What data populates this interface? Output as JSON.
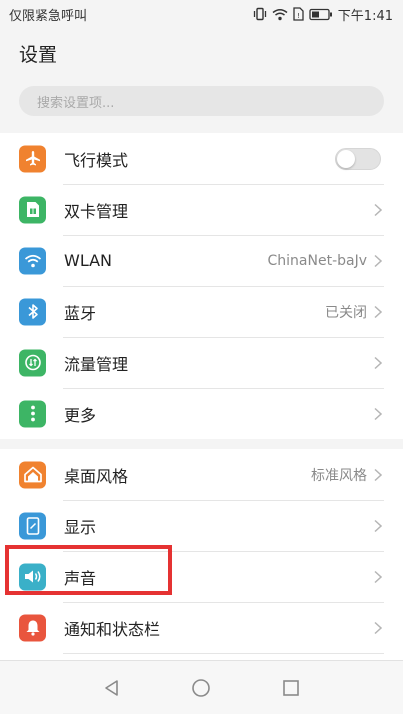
{
  "status_bar": {
    "carrier": "仅限紧急呼叫",
    "time": "下午1:41",
    "icons": [
      "vibrate-icon",
      "wifi-icon",
      "sim-icon",
      "battery-icon"
    ]
  },
  "page_title": "设置",
  "search": {
    "placeholder": "搜索设置项..."
  },
  "groups": [
    {
      "items": [
        {
          "label": "飞行模式",
          "icon": "airplane-icon",
          "icon_color": "#f0822f",
          "control": "toggle",
          "toggle_on": false
        },
        {
          "label": "双卡管理",
          "icon": "sim-card-icon",
          "icon_color": "#3db565",
          "control": "chevron"
        },
        {
          "label": "WLAN",
          "icon": "wifi-icon",
          "icon_color": "#3a98d8",
          "value": "ChinaNet-baJv",
          "control": "chevron"
        },
        {
          "label": "蓝牙",
          "icon": "bluetooth-icon",
          "icon_color": "#3a98d8",
          "value": "已关闭",
          "control": "chevron"
        },
        {
          "label": "流量管理",
          "icon": "data-usage-icon",
          "icon_color": "#3db565",
          "control": "chevron"
        },
        {
          "label": "更多",
          "icon": "more-icon",
          "icon_color": "#3db565",
          "control": "chevron"
        }
      ]
    },
    {
      "items": [
        {
          "label": "桌面风格",
          "icon": "home-style-icon",
          "icon_color": "#f0822f",
          "value": "标准风格",
          "control": "chevron"
        },
        {
          "label": "显示",
          "icon": "display-icon",
          "icon_color": "#3a98d8",
          "control": "chevron"
        },
        {
          "label": "声音",
          "icon": "sound-icon",
          "icon_color": "#3ab0c8",
          "control": "chevron",
          "highlighted": true
        },
        {
          "label": "通知和状态栏",
          "icon": "notification-icon",
          "icon_color": "#e9553d",
          "control": "chevron"
        }
      ]
    }
  ],
  "navigation_bar": [
    "back-icon",
    "home-icon",
    "recents-icon"
  ],
  "colors": {
    "highlight_box": "#e53232",
    "background": "#f4f4f4",
    "chevron": "#b5b5b5"
  }
}
